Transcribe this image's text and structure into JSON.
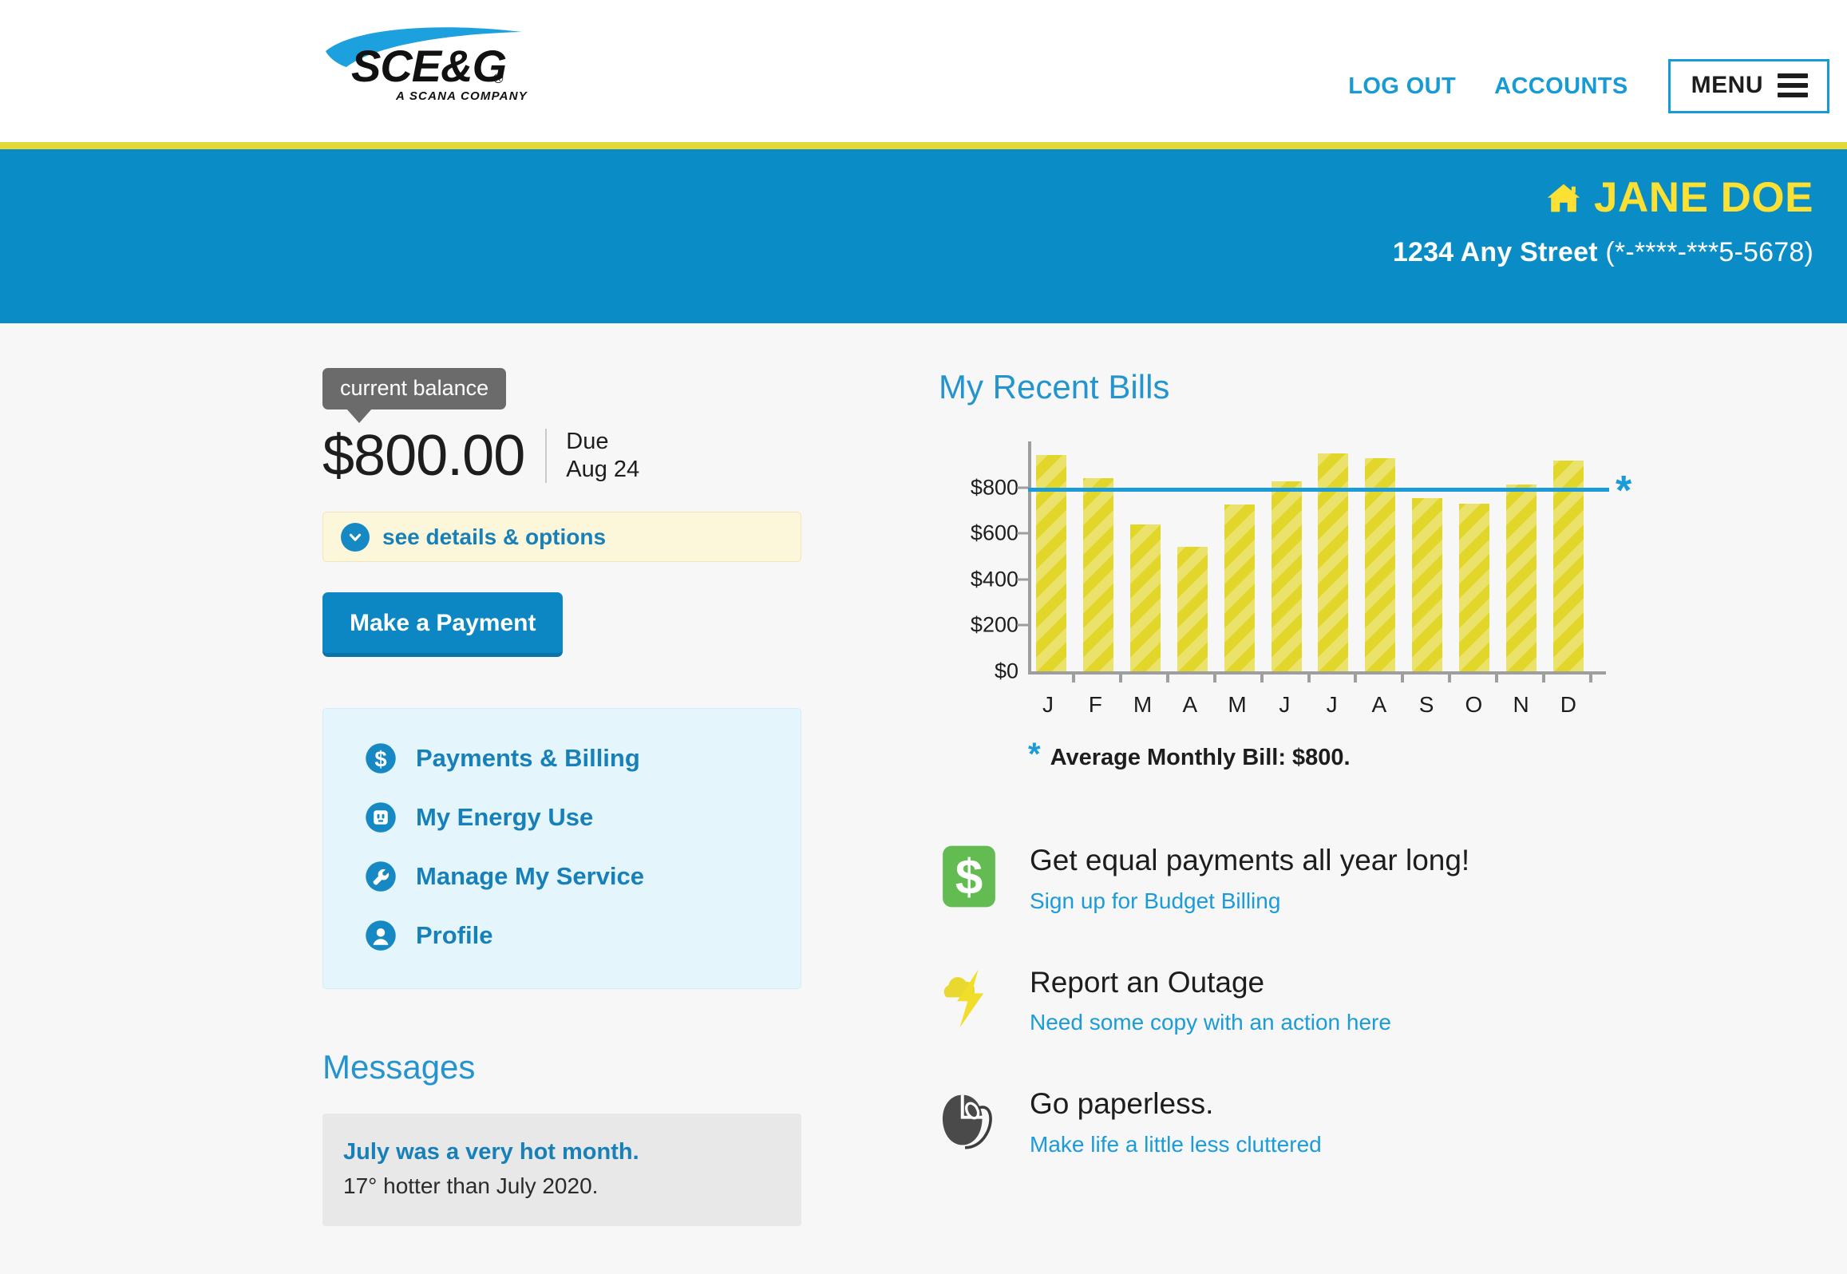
{
  "header": {
    "logo": {
      "brand": "SCE&G",
      "registered": "®",
      "tagline": "A SCANA COMPANY"
    },
    "nav": [
      {
        "label": "LOG OUT",
        "name": "nav-log-out"
      },
      {
        "label": "ACCOUNTS",
        "name": "nav-accounts"
      }
    ],
    "menu_label": "MENU",
    "accent_blue": "#169BD5",
    "rule_yellow": "#E6D836"
  },
  "account_banner": {
    "name": "JANE DOE",
    "street": "1234 Any Street",
    "account_number": "(*-****-***5-5678)",
    "background": "#0A8DC6",
    "name_color": "#FCE033"
  },
  "balance": {
    "tooltip_label": "current balance",
    "amount": "$800.00",
    "due_line1": "Due",
    "due_line2": "Aug 24",
    "details_label": "see details & options",
    "pay_button_label": "Make a Payment"
  },
  "quicklinks": [
    {
      "label": "Payments & Billing",
      "icon": "dollar-circle-icon"
    },
    {
      "label": "My Energy Use",
      "icon": "outlet-circle-icon"
    },
    {
      "label": "Manage My Service",
      "icon": "wrench-circle-icon"
    },
    {
      "label": "Profile",
      "icon": "person-circle-icon"
    }
  ],
  "messages": {
    "heading": "Messages",
    "items": [
      {
        "title": "July was a very hot month.",
        "body": "17° hotter than July 2020."
      }
    ]
  },
  "bills": {
    "heading": "My Recent Bills",
    "footnote_star": "*",
    "footnote_text": "Average Monthly Bill: $800."
  },
  "chart_data": {
    "type": "bar",
    "title": "My Recent Bills",
    "categories": [
      "J",
      "F",
      "M",
      "A",
      "M",
      "J",
      "J",
      "A",
      "S",
      "O",
      "N",
      "D"
    ],
    "values": [
      940,
      840,
      638,
      543,
      727,
      827,
      947,
      928,
      753,
      730,
      812,
      917
    ],
    "ylabel": "",
    "xlabel": "",
    "ylim": [
      0,
      1000
    ],
    "yticks": [
      0,
      200,
      400,
      600,
      800
    ],
    "ytick_labels": [
      "$0",
      "$200",
      "$400",
      "$600",
      "$800"
    ],
    "grid": false,
    "legend": false,
    "bar_color": "#E3D62B",
    "reference_line": {
      "value": 800,
      "label": "Average Monthly Bill: $800.",
      "color": "#1B9BD8",
      "marker": "*"
    }
  },
  "promos": [
    {
      "icon": "dollar-badge-icon",
      "title": "Get equal payments all year long!",
      "link": "Sign up for Budget Billing"
    },
    {
      "icon": "lightning-cloud-icon",
      "title": "Report an Outage",
      "link": "Need some copy with an action here"
    },
    {
      "icon": "computer-mouse-icon",
      "title": "Go paperless.",
      "link": "Make life a little less cluttered"
    }
  ]
}
